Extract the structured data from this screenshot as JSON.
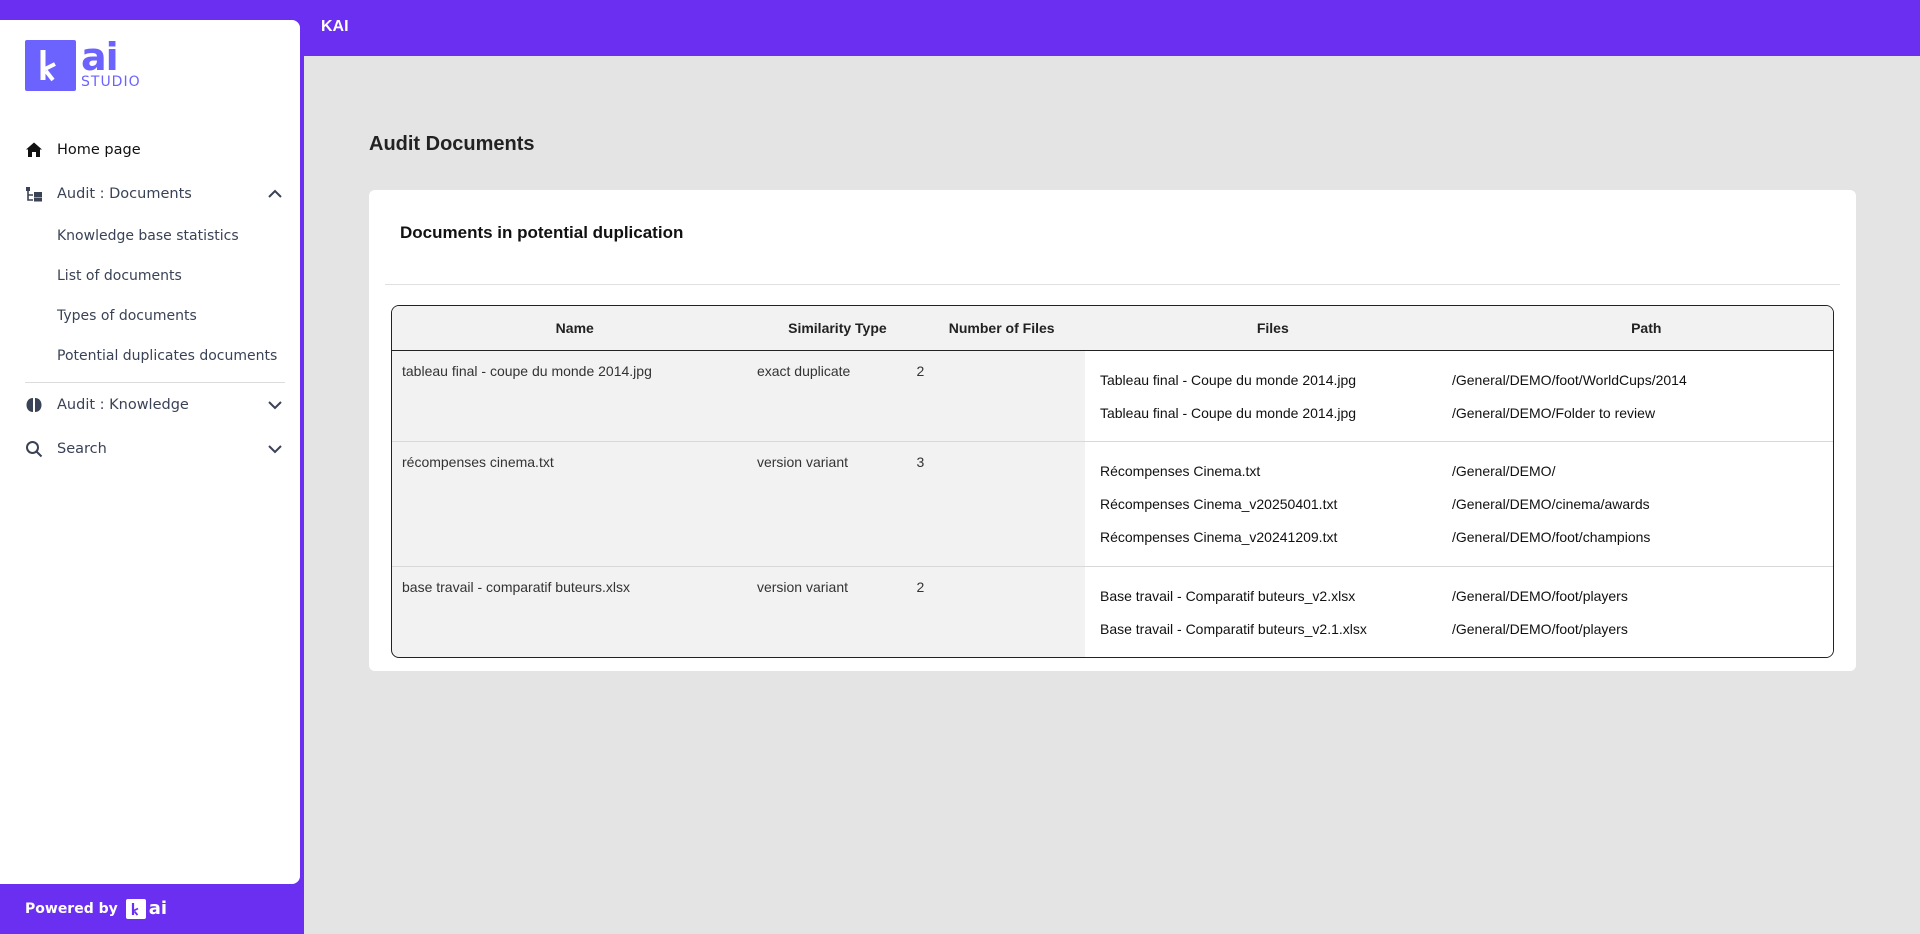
{
  "app": {
    "topbar_title": "KAI",
    "logo_ai": "ai",
    "logo_studio": "STUDIO",
    "powered_by": "Powered by",
    "powered_ai": "ai"
  },
  "sidebar": {
    "home": "Home page",
    "audit_documents": "Audit : Documents",
    "sub_items": [
      "Knowledge base statistics",
      "List of documents",
      "Types of documents",
      "Potential duplicates documents"
    ],
    "audit_knowledge": "Audit : Knowledge",
    "search": "Search"
  },
  "main": {
    "page_title": "Audit Documents",
    "card_title": "Documents in potential duplication",
    "columns": [
      "Name",
      "Similarity Type",
      "Number of Files",
      "Files",
      "Path"
    ],
    "rows": [
      {
        "name": "tableau final - coupe du monde 2014.jpg",
        "similarity": "exact duplicate",
        "count": "2",
        "files": [
          {
            "file": "Tableau final - Coupe du monde 2014.jpg",
            "path": "/General/DEMO/foot/WorldCups/2014"
          },
          {
            "file": "Tableau final - Coupe du monde 2014.jpg",
            "path": "/General/DEMO/Folder to review"
          }
        ]
      },
      {
        "name": "récompenses cinema.txt",
        "similarity": "version variant",
        "count": "3",
        "files": [
          {
            "file": "Récompenses Cinema.txt",
            "path": "/General/DEMO/"
          },
          {
            "file": "Récompenses Cinema_v20250401.txt",
            "path": "/General/DEMO/cinema/awards"
          },
          {
            "file": "Récompenses Cinema_v20241209.txt",
            "path": "/General/DEMO/foot/champions"
          }
        ]
      },
      {
        "name": "base travail - comparatif buteurs.xlsx",
        "similarity": "version variant",
        "count": "2",
        "files": [
          {
            "file": "Base travail - Comparatif buteurs_v2.xlsx",
            "path": "/General/DEMO/foot/players"
          },
          {
            "file": "Base travail - Comparatif buteurs_v2.1.xlsx",
            "path": "/General/DEMO/foot/players"
          }
        ]
      }
    ]
  },
  "colors": {
    "brand": "#6b2ff2",
    "logo": "#6c63ff",
    "background": "#e4e4e4"
  }
}
